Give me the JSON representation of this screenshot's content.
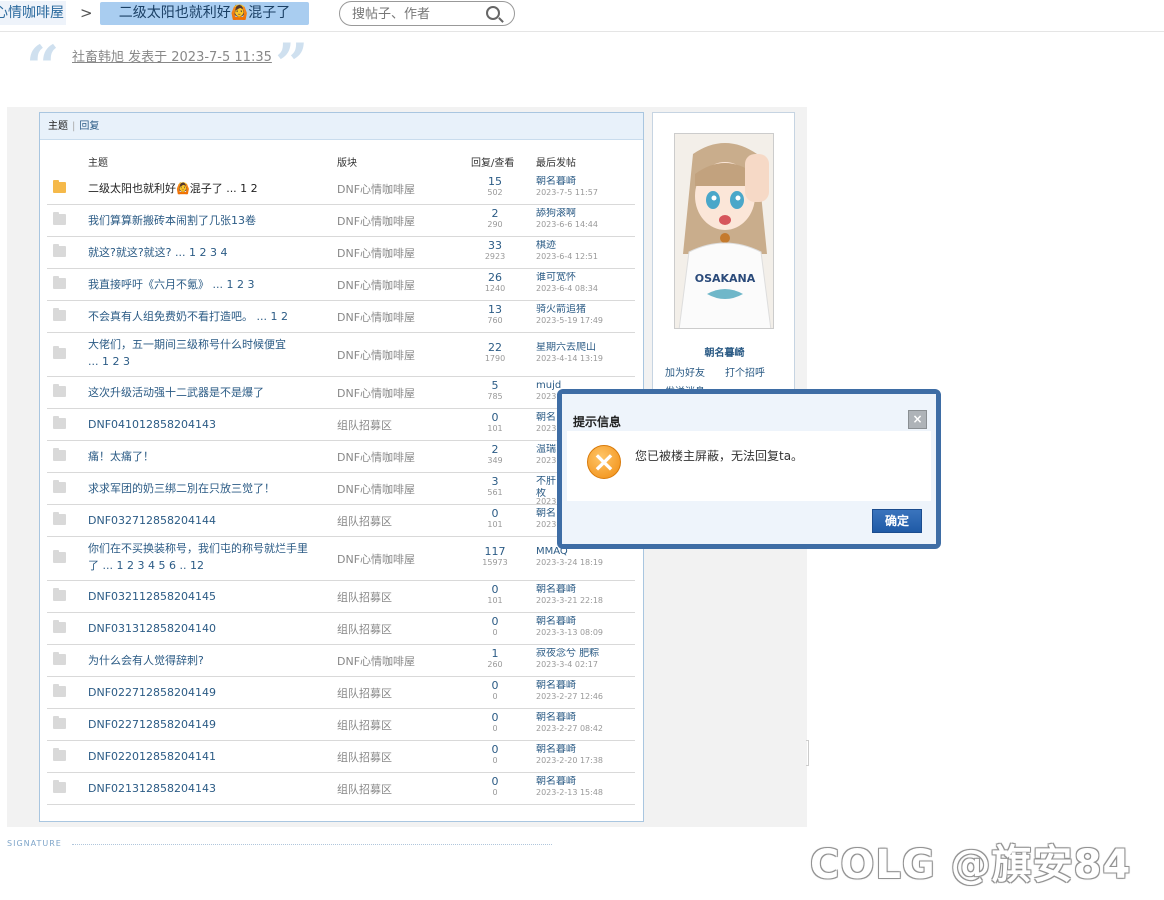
{
  "breadcrumb": {
    "forum": "心情咖啡屋",
    "separator": ">",
    "thread": "二级太阳也就利好🙆混子了"
  },
  "search": {
    "placeholder": "搜帖子、作者"
  },
  "post": {
    "author_line": "社畜韩旭 发表于 2023-7-5 11:35"
  },
  "list": {
    "tabs": [
      "主题",
      "回复"
    ],
    "headers": {
      "topic": "主题",
      "forum": "版块",
      "reply_view": "回复/查看",
      "last": "最后发帖"
    },
    "rows": [
      {
        "title": "二级太阳也就利好🙆混子了 ... 1  2",
        "forum": "DNF心情咖啡屋",
        "replies": "15",
        "views": "502",
        "last_user": "朝名暮崎",
        "last_time": "2023-7-5 11:57",
        "hot": true
      },
      {
        "title": "我们算算新搬砖本闹割了几张13卷",
        "forum": "DNF心情咖啡屋",
        "replies": "2",
        "views": "290",
        "last_user": "舔狗滚啊",
        "last_time": "2023-6-6 14:44"
      },
      {
        "title": "就这?就这?就这? ... 1  2  3  4",
        "forum": "DNF心情咖啡屋",
        "replies": "33",
        "views": "2923",
        "last_user": "棋迹",
        "last_time": "2023-6-4 12:51"
      },
      {
        "title": "我直接呼吁《六月不氪》 ... 1  2  3",
        "forum": "DNF心情咖啡屋",
        "replies": "26",
        "views": "1240",
        "last_user": "谁可宽怀",
        "last_time": "2023-6-4 08:34"
      },
      {
        "title": "不会真有人组免费奶不看打造吧。 ... 1  2",
        "forum": "DNF心情咖啡屋",
        "replies": "13",
        "views": "760",
        "last_user": "骑火箭追猪",
        "last_time": "2023-5-19 17:49"
      },
      {
        "title": "大佬们，五一期间三级称号什么时候便宜",
        "title2": "... 1  2  3",
        "forum": "DNF心情咖啡屋",
        "replies": "22",
        "views": "1790",
        "last_user": "星期六去爬山",
        "last_time": "2023-4-14 13:19"
      },
      {
        "title": "这次升级活动强十二武器是不是爆了",
        "forum": "DNF心情咖啡屋",
        "replies": "5",
        "views": "785",
        "last_user": "mujd",
        "last_time": "2023"
      },
      {
        "title": "DNF041012858204143",
        "forum": "组队招募区",
        "replies": "0",
        "views": "101",
        "last_user": "朝名",
        "last_time": "2023"
      },
      {
        "title": "痛！太痛了！",
        "forum": "DNF心情咖啡屋",
        "replies": "2",
        "views": "349",
        "last_user": "温瑞",
        "last_time": "2023"
      },
      {
        "title": "求求军团的奶三绑二別在只放三觉了！",
        "forum": "DNF心情咖啡屋",
        "replies": "3",
        "views": "561",
        "last_user": "不肝",
        "last_user2": "枚",
        "last_time": "2023"
      },
      {
        "title": "DNF032712858204144",
        "forum": "组队招募区",
        "replies": "0",
        "views": "101",
        "last_user": "朝名",
        "last_time": "2023"
      },
      {
        "title": "你们在不买换装称号，我们屯的称号就烂手里",
        "title2": "了 ... 1  2  3  4  5  6 .. 12",
        "forum": "DNF心情咖啡屋",
        "replies": "117",
        "views": "15973",
        "last_user": "MMAQ",
        "last_time": "2023-3-24 18:19"
      },
      {
        "title": "DNF032112858204145",
        "forum": "组队招募区",
        "replies": "0",
        "views": "101",
        "last_user": "朝名暮崎",
        "last_time": "2023-3-21 22:18"
      },
      {
        "title": "DNF031312858204140",
        "forum": "组队招募区",
        "replies": "0",
        "views": "0",
        "last_user": "朝名暮崎",
        "last_time": "2023-3-13 08:09"
      },
      {
        "title": "为什么会有人觉得辞刺?",
        "forum": "DNF心情咖啡屋",
        "replies": "1",
        "views": "260",
        "last_user": "寂夜念兮 肥粽",
        "last_time": "2023-3-4 02:17"
      },
      {
        "title": "DNF022712858204149",
        "forum": "组队招募区",
        "replies": "0",
        "views": "0",
        "last_user": "朝名暮崎",
        "last_time": "2023-2-27 12:46"
      },
      {
        "title": "DNF022712858204149",
        "forum": "组队招募区",
        "replies": "0",
        "views": "0",
        "last_user": "朝名暮崎",
        "last_time": "2023-2-27 08:42"
      },
      {
        "title": "DNF022012858204141",
        "forum": "组队招募区",
        "replies": "0",
        "views": "0",
        "last_user": "朝名暮崎",
        "last_time": "2023-2-20 17:38"
      },
      {
        "title": "DNF021312858204143",
        "forum": "组队招募区",
        "replies": "0",
        "views": "0",
        "last_user": "朝名暮崎",
        "last_time": "2023-2-13 15:48"
      }
    ]
  },
  "profile": {
    "name": "朝名暮崎",
    "add_friend": "加为好友",
    "greet": "打个招呼",
    "send_msg": "发送消息",
    "shirt_text": "OSAKANA"
  },
  "modal": {
    "title": "提示信息",
    "close": "×",
    "message": "您已被楼主屏蔽，无法回复ta。",
    "ok": "确定"
  },
  "signature": {
    "label": "SIGNATURE"
  },
  "watermark": {
    "text": "@旗安84",
    "logo_text": "COLG"
  },
  "colors": {
    "link": "#2b5b85",
    "modal_border": "#3e6da5",
    "accent_orange": "#f08c12"
  }
}
